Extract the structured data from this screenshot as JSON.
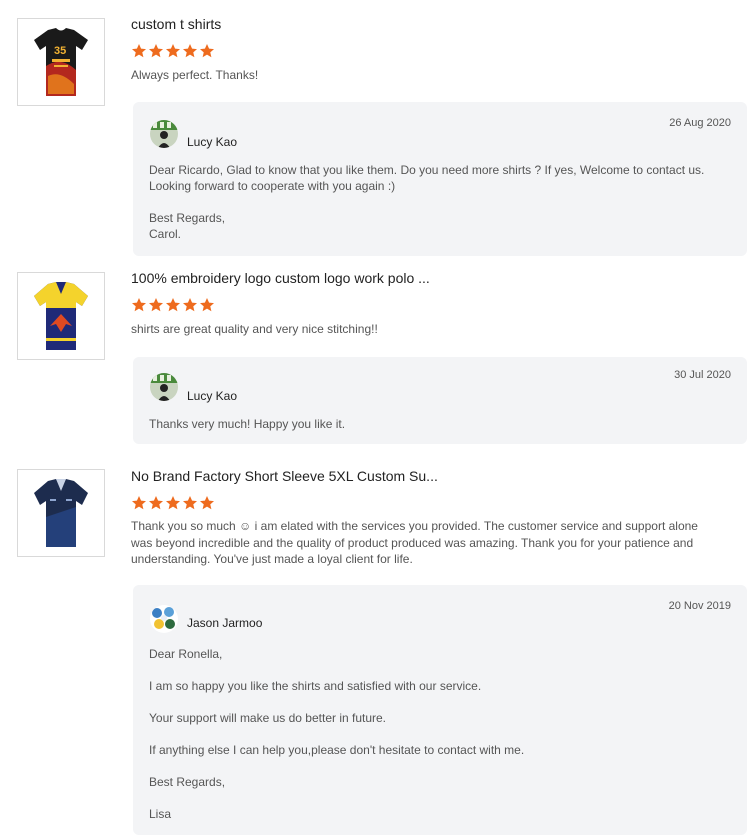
{
  "colors": {
    "star": "#ee6b1e",
    "reply_bg": "#f3f4f6"
  },
  "reviews": [
    {
      "product_title": "custom t shirts",
      "rating": 5,
      "comment": "Always perfect. Thanks!",
      "thumbnail_icon": "black-tshirt-thumbnail",
      "reply": {
        "name": "Lucy Kao",
        "date": "26 Aug 2020",
        "lines": [
          "Dear Ricardo,  Glad to know that you like them.  Do you need more shirts ? If yes, Welcome to contact us.",
          "Looking forward to cooperate with you again :)",
          "",
          "Best Regards,",
          "Carol."
        ]
      }
    },
    {
      "product_title": "100% embroidery logo custom logo work polo ...",
      "rating": 5,
      "comment": "shirts are great quality and very nice stitching!!",
      "thumbnail_icon": "yellow-polo-thumbnail",
      "reply": {
        "name": "Lucy Kao",
        "date": "30 Jul 2020",
        "lines": [
          "Thanks very much! Happy you like it."
        ]
      }
    },
    {
      "product_title": "No Brand Factory Short Sleeve 5XL Custom Su...",
      "rating": 5,
      "comment": "Thank you so much ☺ i am elated with the services you provided. The customer service and support alone was beyond incredible and the quality of product produced was amazing. Thank you for your patience and understanding. You've just made a loyal client for life.",
      "thumbnail_icon": "navy-polo-thumbnail",
      "reply": {
        "name": "Jason Jarmoo",
        "date": "20 Nov 2019",
        "lines": [
          "Dear Ronella,",
          "",
          "I am so happy you like the shirts and satisfied with our service.",
          "",
          "Your support will make us do better in future.",
          "",
          "If anything else I can help you,please don't hesitate to contact with me.",
          "",
          "Best Regards,",
          "",
          "Lisa"
        ]
      }
    }
  ]
}
